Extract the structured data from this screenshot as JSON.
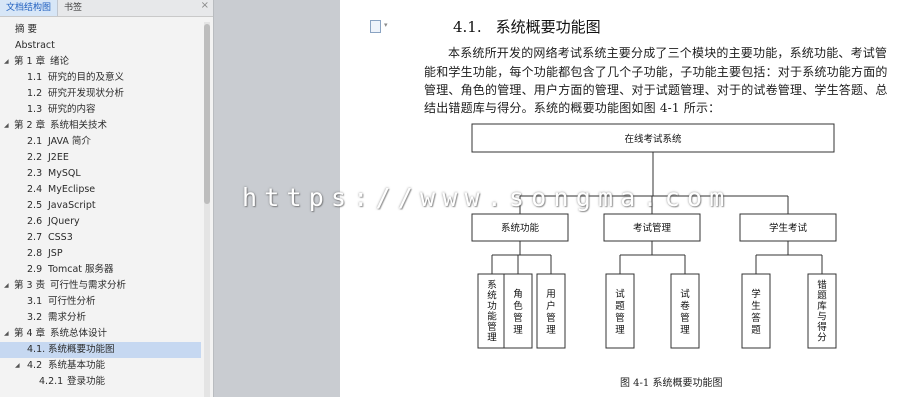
{
  "sidebar": {
    "tabs": [
      {
        "label": "文档结构图",
        "active": true
      },
      {
        "label": "书签",
        "active": false
      }
    ],
    "close_glyph": "×",
    "toc": [
      {
        "level": 0,
        "num": "",
        "label": "摘 要",
        "expander": ""
      },
      {
        "level": 0,
        "num": "",
        "label": "Abstract",
        "expander": ""
      },
      {
        "level": 0,
        "num": "第 1 章",
        "label": "绪论",
        "expander": "◢"
      },
      {
        "level": 1,
        "num": "1.1",
        "label": "研究的目的及意义",
        "expander": ""
      },
      {
        "level": 1,
        "num": "1.2",
        "label": "研究开发现状分析",
        "expander": ""
      },
      {
        "level": 1,
        "num": "1.3",
        "label": "研究的内容",
        "expander": ""
      },
      {
        "level": 0,
        "num": "第 2 章",
        "label": "系统相关技术",
        "expander": "◢"
      },
      {
        "level": 1,
        "num": "2.1",
        "label": "JAVA 简介",
        "expander": ""
      },
      {
        "level": 1,
        "num": "2.2",
        "label": "J2EE",
        "expander": ""
      },
      {
        "level": 1,
        "num": "2.3",
        "label": "MySQL",
        "expander": ""
      },
      {
        "level": 1,
        "num": "2.4",
        "label": "MyEclipse",
        "expander": ""
      },
      {
        "level": 1,
        "num": "2.5",
        "label": "JavaScript",
        "expander": ""
      },
      {
        "level": 1,
        "num": "2.6",
        "label": "JQuery",
        "expander": ""
      },
      {
        "level": 1,
        "num": "2.7",
        "label": "CSS3",
        "expander": ""
      },
      {
        "level": 1,
        "num": "2.8",
        "label": "JSP",
        "expander": ""
      },
      {
        "level": 1,
        "num": "2.9",
        "label": "Tomcat 服务器",
        "expander": ""
      },
      {
        "level": 0,
        "num": "第 3 责",
        "label": "可行性与需求分析",
        "expander": "◢"
      },
      {
        "level": 1,
        "num": "3.1",
        "label": "可行性分析",
        "expander": ""
      },
      {
        "level": 1,
        "num": "3.2",
        "label": "需求分析",
        "expander": ""
      },
      {
        "level": 0,
        "num": "第 4 章",
        "label": "系统总体设计",
        "expander": "◢"
      },
      {
        "level": 1,
        "num": "4.1.",
        "label": "系统概要功能图",
        "expander": "",
        "selected": true
      },
      {
        "level": 1,
        "num": "4.2",
        "label": "系统基本功能",
        "expander": "◢"
      },
      {
        "level": 2,
        "num": "4.2.1",
        "label": "登录功能",
        "expander": ""
      }
    ]
  },
  "page": {
    "heading_num": "4.1.",
    "heading_text": "系统概要功能图",
    "paragraph_lines": [
      "本系统所开发的网络考试系统主要分成了三个模块的主要功能，系统功能、考试管",
      "能和学生功能，每个功能都包含了几个子功能，子功能主要包括：对于系统功能方面的",
      "管理、角色的管理、用户方面的管理、对于试题管理、对于的试卷管理、学生答题、总",
      "结出错题库与得分。系统的概要功能图如图 4-1 所示："
    ],
    "figure_caption": "图 4-1  系统概要功能图"
  },
  "diagram": {
    "root": "在线考试系统",
    "modules": [
      {
        "name": "系统功能",
        "children": [
          "系统功能管理",
          "角色管理",
          "用户管理"
        ]
      },
      {
        "name": "考试管理",
        "children": [
          "试题管理",
          "试卷管理"
        ]
      },
      {
        "name": "学生考试",
        "children": [
          "学生答题",
          "错题库与得分"
        ]
      }
    ]
  },
  "watermark": "https://www.songma.com"
}
